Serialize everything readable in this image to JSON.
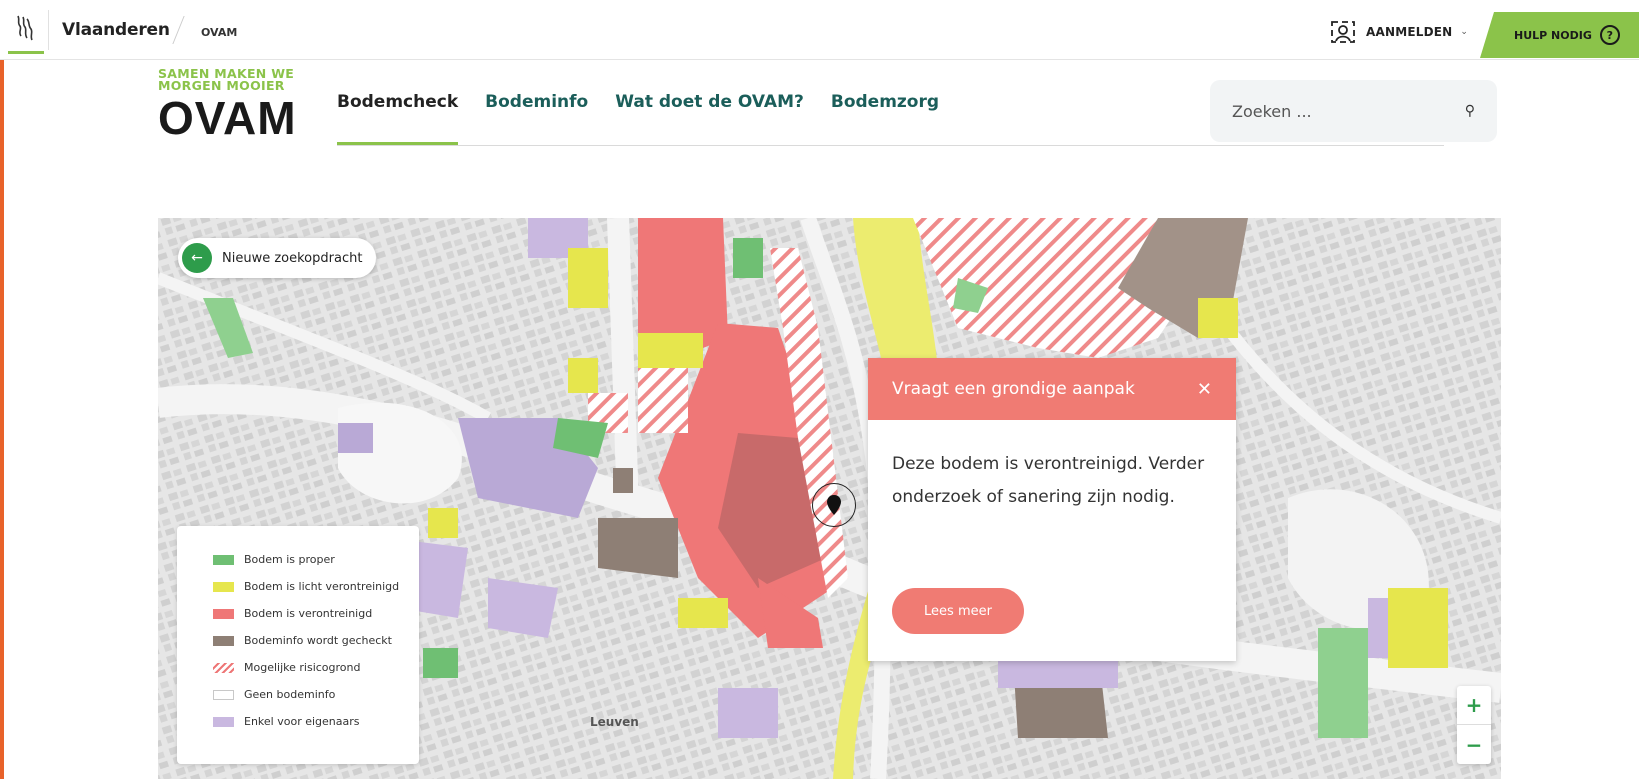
{
  "topbar": {
    "gov_name": "Vlaanderen",
    "org_short": "OVAM",
    "login_label": "AANMELDEN",
    "help_label": "HULP NODIG",
    "help_icon_glyph": "?"
  },
  "brand": {
    "tagline_line1": "SAMEN MAKEN WE",
    "tagline_line2": "MORGEN MOOIER",
    "logo": "OVAM"
  },
  "nav": {
    "items": [
      {
        "label": "Bodemcheck",
        "active": true
      },
      {
        "label": "Bodeminfo",
        "active": false
      },
      {
        "label": "Wat doet de OVAM?",
        "active": false
      },
      {
        "label": "Bodemzorg",
        "active": false
      }
    ]
  },
  "search": {
    "placeholder": "Zoeken ..."
  },
  "map": {
    "back_label": "Nieuwe zoekopdracht",
    "city_label": "Leuven",
    "legend": [
      {
        "label": "Bodem is proper",
        "color": "#6fbf73"
      },
      {
        "label": "Bodem is licht verontreinigd",
        "color": "#e6e64d"
      },
      {
        "label": "Bodem is verontreinigd",
        "color": "#ef7777"
      },
      {
        "label": "Bodeminfo wordt gecheckt",
        "color": "#8e7f75"
      },
      {
        "label": "Mogelijke risicogrond",
        "color": "hatch"
      },
      {
        "label": "Geen bodeminfo",
        "color": "empty"
      },
      {
        "label": "Enkel voor eigenaars",
        "color": "#c9b8e0"
      }
    ],
    "popup": {
      "title": "Vraagt een grondige aanpak",
      "body": "Deze bodem is verontreinigd. Verder onderzoek of sanering zijn nodig.",
      "button": "Lees meer"
    },
    "zoom_in": "+",
    "zoom_out": "−"
  },
  "colors": {
    "accent_green": "#8bc34a",
    "nav_teal": "#1b5e5a",
    "popup_red": "#f07b73",
    "button_green": "#2e9c4b"
  }
}
